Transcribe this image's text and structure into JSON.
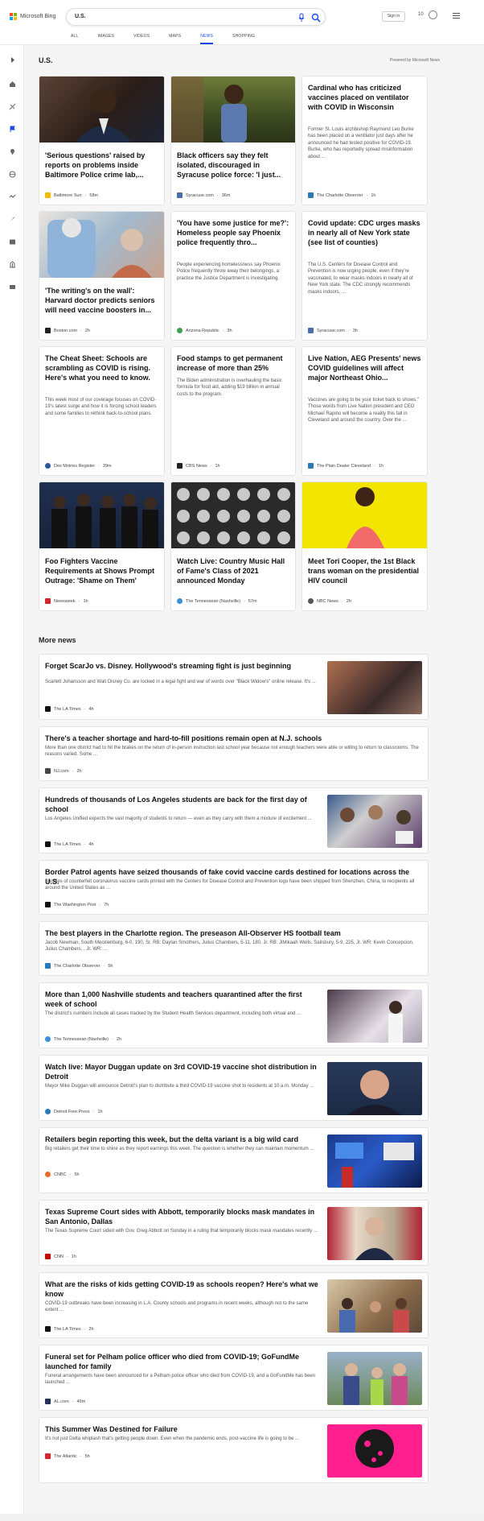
{
  "app": {
    "brand": "Microsoft Bing",
    "signin": "Sign in",
    "rewards_count": "10"
  },
  "search": {
    "value": "U.S.",
    "placeholder": ""
  },
  "tabs": [
    {
      "label": "ALL"
    },
    {
      "label": "IMAGES"
    },
    {
      "label": "VIDEOS"
    },
    {
      "label": "MAPS"
    },
    {
      "label": "NEWS"
    },
    {
      "label": "SHOPPING"
    }
  ],
  "section": {
    "title": "U.S.",
    "powered": "Powered by Microsoft News",
    "more_title": "More news"
  },
  "cards": [
    {
      "title": "'Serious questions' raised by reports on problems inside Baltimore Police crime lab,...",
      "desc": "",
      "source": "Baltimore Sun",
      "time": "58m",
      "fav_color": "#f5b800"
    },
    {
      "title": "Black officers say they felt isolated, discouraged in Syracuse police force: 'I just...",
      "desc": "",
      "source": "Syracuse.com",
      "time": "36m",
      "fav_color": "#4a6fa5"
    },
    {
      "title": "Cardinal who has criticized vaccines placed on ventilator with COVID in Wisconsin",
      "desc": "Former St. Louis archbishop Raymond Leo Burke has been placed on a ventilator just days after he announced he had tested positive for COVID-19. Burke, who has reportedly spread misinformation about ...",
      "source": "The Charlotte Observer",
      "time": "1h",
      "fav_color": "#2a7ab8"
    },
    {
      "title": "'The writing's on the wall': Harvard doctor predicts seniors will need vaccine boosters in...",
      "desc": "",
      "source": "Boston.com",
      "time": "2h",
      "fav_color": "#222222"
    },
    {
      "title": "'You have some justice for me?': Homeless people say Phoenix police frequently thro...",
      "desc": "People experiencing homelessness say Phoenix Police frequently throw away their belongings, a practice the Justice Department is investigating.",
      "source": "Arizona Republic",
      "time": "3h",
      "fav_color": "#3fa34d"
    },
    {
      "title": "Covid update: CDC urges masks in nearly all of New York state (see list of counties)",
      "desc": "The U.S. Centers for Disease Control and Prevention is now urging people, even if they're vaccinated, to wear masks indoors in nearly all of New York state. The CDC strongly recommends masks indoors, ...",
      "source": "Syracuse.com",
      "time": "3h",
      "fav_color": "#4a6fa5"
    },
    {
      "title": "The Cheat Sheet: Schools are scrambling as COVID is rising. Here's what you need to know.",
      "desc": "This week most of our coverage focuses on COVID-19's latest surge and how it is forcing school leaders and some families to rethink back-to-school plans.",
      "source": "Des Moines Register",
      "time": "39m",
      "fav_color": "#2c56a0"
    },
    {
      "title": "Food stamps to get permanent increase of more than 25%",
      "desc": "The Biden administration is overhauling the basic formula for food aid, adding $19 billion in annual costs to the program.",
      "source": "CBS News",
      "time": "1h",
      "fav_color": "#222222"
    },
    {
      "title": "Live Nation, AEG Presents' news COVID guidelines will affect major Northeast Ohio...",
      "desc": "Vaccines are going to be your ticket back to shows.\" Those words from Live Nation president and CEO Michael Rapino will become a reality this fall in Cleveland and around the country. Over the ...",
      "source": "The Plain Dealer Cleveland",
      "time": "1h",
      "fav_color": "#2a7ab8"
    },
    {
      "title": "Foo Fighters Vaccine Requirements at Shows Prompt Outrage: 'Shame on Them'",
      "desc": "",
      "source": "Newsweek",
      "time": "1h",
      "fav_color": "#d9232d"
    },
    {
      "title": "Watch Live: Country Music Hall of Fame's Class of 2021 announced Monday",
      "desc": "",
      "source": "The Tennessean (Nashville)",
      "time": "57m",
      "fav_color": "#3b8fd6"
    },
    {
      "title": "Meet Tori Cooper, the 1st Black trans woman on the presidential HIV council",
      "desc": "",
      "source": "NBC News",
      "time": "2h",
      "fav_color": "#555555"
    }
  ],
  "more_news": [
    {
      "title": "Forget ScarJo vs. Disney. Hollywood's streaming fight is just beginning",
      "desc": "Scarlett Johansson and Walt Disney Co. are locked in a legal fight and war of words over \"Black Widow's\" online release. It's ...",
      "source": "The LA Times",
      "time": "4h",
      "fav_color": "#111111"
    },
    {
      "title": "There's a teacher shortage and hard-to-fill positions remain open at N.J. schools",
      "desc": "More than one district had to hit the brakes on the return of in-person instruction last school year because not enough teachers were able or willing to return to classrooms. The reasons varied. Some ...",
      "source": "NJ.com",
      "time": "2h",
      "fav_color": "#444444"
    },
    {
      "title": "Hundreds of thousands of Los Angeles students are back for the first day of school",
      "desc": "Los Angeles Unified expects the vast majority of students to return — even as they carry with them a mixture of excitement ...",
      "source": "The LA Times",
      "time": "4h",
      "fav_color": "#111111"
    },
    {
      "title": "Border Patrol agents have seized thousands of fake covid vaccine cards destined for locations across the U.S.",
      "desc": "Bundles of counterfeit coronavirus vaccine cards printed with the Centers for Disease Control and Prevention logo have been shipped from Shenzhen, China, to recipients all around the United States as ...",
      "source": "The Washington Post",
      "time": "7h",
      "fav_color": "#111111"
    },
    {
      "title": "The best players in the Charlotte region. The preseason All-Observer HS football team",
      "desc": "Jacob Newman, South Mecklenburg, 6-0, 190, Sr. RB: Daylan Smothers, Julius Chambers, 5-11, 180, Jr. RB: JiMikaah Wells, Salisbury, 5-9, 225, Jr. WR: Kevin Concepcion, Julius Chambers, , Jr. WR: ...",
      "source": "The Charlotte Observer",
      "time": "5h",
      "fav_color": "#2a7ab8"
    },
    {
      "title": "More than 1,000 Nashville students and teachers quarantined after the first week of school",
      "desc": "The district's numbers include all cases tracked by the Student Health Services department, including both virtual and ...",
      "source": "The Tennessean (Nashville)",
      "time": "2h",
      "fav_color": "#3b8fd6"
    },
    {
      "title": "Watch live: Mayor Duggan update on 3rd COVID-19 vaccine shot distribution in Detroit",
      "desc": "Mayor Mike Duggan will announce Detroit's plan to distribute a third COVID-19 vaccine shot to residents at 10 a.m. Monday ...",
      "source": "Detroit Free Press",
      "time": "1h",
      "fav_color": "#2a7ab8"
    },
    {
      "title": "Retailers begin reporting this week, but the delta variant is a big wild card",
      "desc": "Big retailers get their time to shine as they report earnings this week. The question is whether they can maintain momentum ...",
      "source": "CNBC",
      "time": "5h",
      "fav_color": "#e66b2c"
    },
    {
      "title": "Texas Supreme Court sides with Abbott, temporarily blocks mask mandates in San Antonio, Dallas",
      "desc": "The Texas Supreme Court sided with Gov. Greg Abbott on Sunday in a ruling that temporarily blocks mask mandates recently ...",
      "source": "CNN",
      "time": "1h",
      "fav_color": "#cc0000"
    },
    {
      "title": "What are the risks of kids getting COVID-19 as schools reopen? Here's what we know",
      "desc": "COVID-19 outbreaks have been increasing in L.A. County schools and programs in recent weeks, although not to the same extent ...",
      "source": "The LA Times",
      "time": "2h",
      "fav_color": "#111111"
    },
    {
      "title": "Funeral set for Pelham police officer who died from COVID-19; GoFundMe launched for family",
      "desc": "Funeral arrangements have been announced for a Pelham police officer who died from COVID-19, and a GoFundMe has been launched ...",
      "source": "AL.com",
      "time": "49m",
      "fav_color": "#22335a"
    },
    {
      "title": "This Summer Was Destined for Failure",
      "desc": "It's not just Delta whiplash that's getting people down. Even when the pandemic ends, post-vaccine life is going to be ...",
      "source": "The Atlantic",
      "time": "5h",
      "fav_color": "#d9232d"
    }
  ]
}
